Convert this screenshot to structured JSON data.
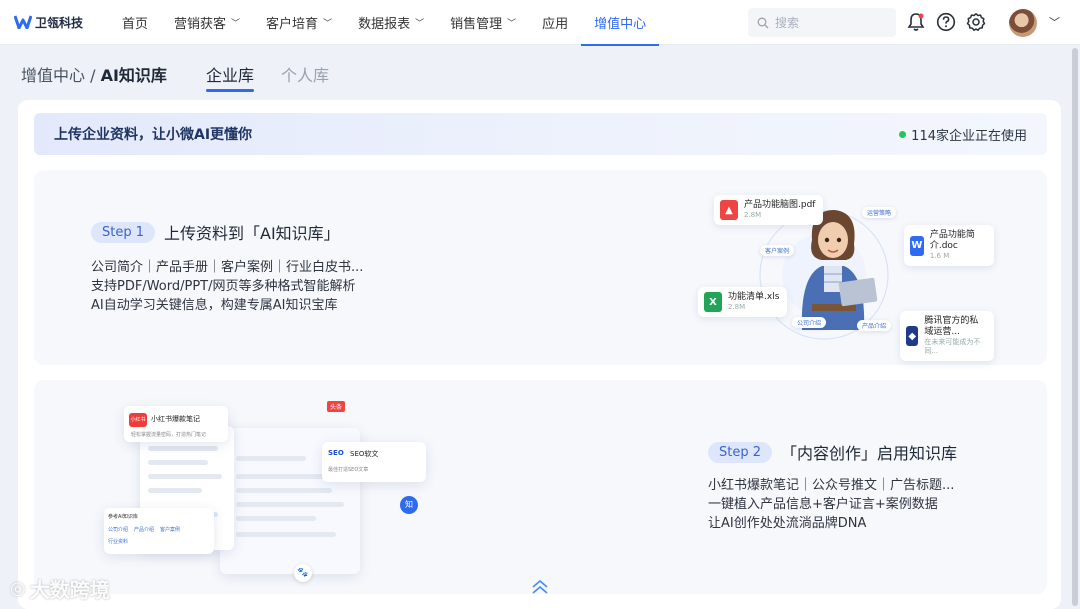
{
  "brand": {
    "name": "卫瓴科技"
  },
  "nav": {
    "items": [
      {
        "label": "首页",
        "dropdown": false
      },
      {
        "label": "营销获客",
        "dropdown": true
      },
      {
        "label": "客户培育",
        "dropdown": true
      },
      {
        "label": "数据报表",
        "dropdown": true
      },
      {
        "label": "销售管理",
        "dropdown": true
      },
      {
        "label": "应用",
        "dropdown": false
      },
      {
        "label": "增值中心",
        "dropdown": false,
        "active": true
      }
    ],
    "search_placeholder": "搜索",
    "icons": [
      "bell-icon",
      "help-icon",
      "gear-icon"
    ]
  },
  "breadcrumb": {
    "parent": "增值中心",
    "separator": " / ",
    "current": "AI知识库"
  },
  "tabs": [
    {
      "label": "企业库",
      "active": true
    },
    {
      "label": "个人库",
      "active": false
    }
  ],
  "banner": {
    "title": "上传企业资料，让小微AI更懂你",
    "status": "114家企业正在使用"
  },
  "step1": {
    "badge": "Step 1",
    "title": "上传资料到「AI知识库」",
    "lines": [
      "公司简介｜产品手册｜客户案例｜行业白皮书...",
      "支持PDF/Word/PPT/网页等多种格式智能解析",
      "AI自动学习关键信息，构建专属AI知识宝库"
    ],
    "files": [
      {
        "name": "产品功能脑图.pdf",
        "size": "2.8M"
      },
      {
        "name": "产品功能简介.doc",
        "size": "1.6 M"
      },
      {
        "name": "功能清单.xls",
        "size": "2.8M"
      },
      {
        "name": "腾讯官方的私域运营...",
        "size": "在未来可能成为不同..."
      }
    ],
    "tags": [
      "运营策略",
      "客户案例",
      "公司介绍",
      "产品介绍"
    ]
  },
  "step2": {
    "badge": "Step 2",
    "title": "「内容创作」启用知识库",
    "lines": [
      "小红书爆款笔记｜公众号推文｜广告标题...",
      "一键植入产品信息+客户证言+案例数据",
      "让AI创作处处流淌品牌DNA"
    ],
    "mock": {
      "xhs_badge": "小红书",
      "xhs_title": "小红书爆款笔记",
      "xhs_sub": "轻松掌握流量密码，打造热门笔记",
      "toutiao": "头条",
      "seo_logo": "SEO",
      "seo_title": "SEO软文",
      "seo_sub": "最佳打造SEO文章",
      "zhi": "知",
      "form_title": "参考AI知识库",
      "form_tags": [
        "公司介绍",
        "产品介绍",
        "客户案例",
        "行业资料"
      ]
    }
  },
  "watermark": "大数跨境"
}
